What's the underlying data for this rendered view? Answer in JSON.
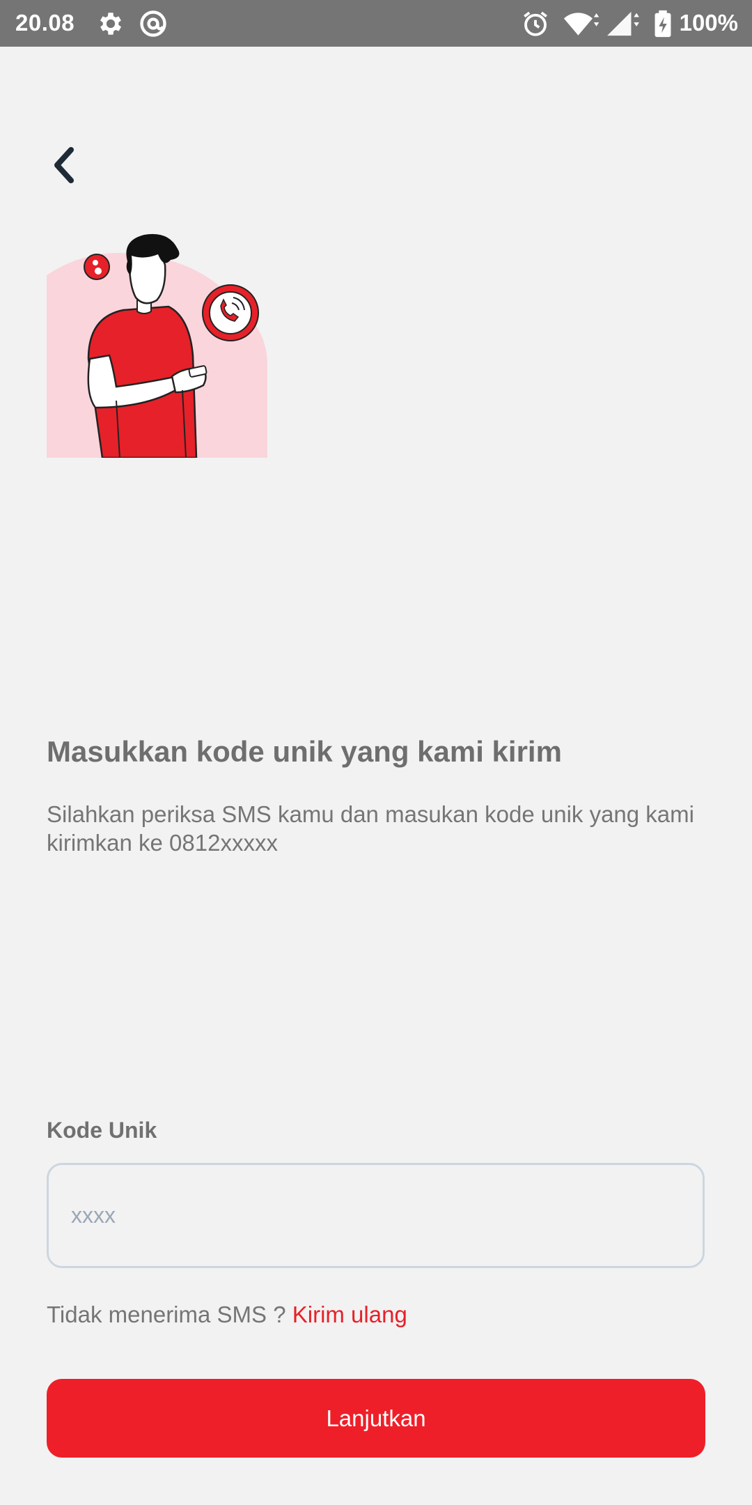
{
  "status_bar": {
    "time": "20.08",
    "battery": "100%",
    "icons": [
      "gear-icon",
      "at-sign-icon",
      "alarm-icon",
      "wifi-icon",
      "signal-icon",
      "battery-charging-icon"
    ]
  },
  "header": {
    "back_icon": "chevron-left-icon"
  },
  "illustration": {
    "description_icon": "person-phone-illustration"
  },
  "main": {
    "title": "Masukkan kode unik yang kami kirim",
    "subtitle": "Silahkan periksa SMS kamu dan masukan kode unik yang kami kirimkan ke 0812xxxxx"
  },
  "form": {
    "label": "Kode Unik",
    "value": "",
    "placeholder": "xxxx"
  },
  "resend": {
    "text": "Tidak menerima SMS ? ",
    "link": "Kirim ulang"
  },
  "actions": {
    "continue_label": "Lanjutkan"
  },
  "colors": {
    "accent": "#ee1f29",
    "background": "#f2f2f2",
    "statusbar": "#757575",
    "pink": "#fbd6dc"
  }
}
